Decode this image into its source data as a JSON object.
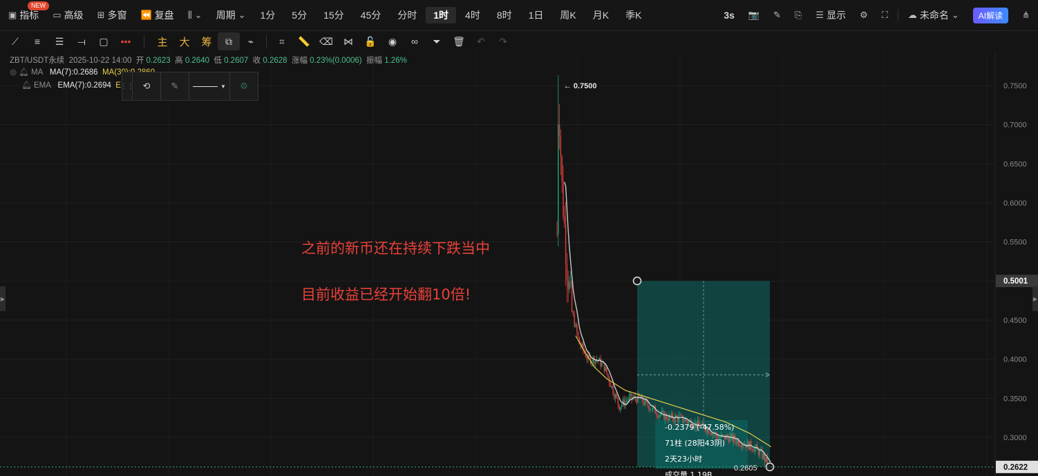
{
  "toolbar": {
    "indicators": "指标",
    "new_badge": "NEW",
    "advanced": "高级",
    "multi_window": "多窗",
    "replay": "复盘",
    "period": "周期",
    "timeframes": [
      "1分",
      "5分",
      "15分",
      "45分",
      "分时",
      "1时",
      "4时",
      "8时",
      "1日",
      "周K",
      "月K",
      "季K"
    ],
    "active_timeframe": "1时",
    "refresh": "3s",
    "display": "显示",
    "unnamed": "未命名",
    "ai": "AI解读"
  },
  "drawbar": {
    "main": "主",
    "big": "大",
    "chips": "筹"
  },
  "legend": {
    "symbol": "ZBT/USDT永续",
    "datetime": "2025-10-22 14:00",
    "open_label": "开",
    "open": "0.2623",
    "high_label": "高",
    "high": "0.2640",
    "low_label": "低",
    "low": "0.2607",
    "close_label": "收",
    "close": "0.2628",
    "change_label": "涨幅",
    "change": "0.23%(0.0006)",
    "amp_label": "振幅",
    "amp": "1.26%",
    "ma_label": "MA",
    "ma7": "MA(7):0.2686",
    "ma30": "MA(30):0.2860",
    "ema_label": "EMA",
    "ema7": "EMA(7):0.2694",
    "ema_more": "E"
  },
  "annotations": {
    "line1": "之前的新币还在持续下跌当中",
    "line2": "目前收益已经开始翻10倍!"
  },
  "chart_data": {
    "type": "candlestick",
    "ylim": [
      0.26,
      0.76
    ],
    "y_ticks": [
      "0.7500",
      "0.7000",
      "0.6500",
      "0.6000",
      "0.5500",
      "0.5000",
      "0.4500",
      "0.4000",
      "0.3500",
      "0.3000"
    ],
    "y_tick_values": [
      0.75,
      0.7,
      0.65,
      0.6,
      0.55,
      0.5,
      0.45,
      0.4,
      0.35,
      0.3
    ],
    "high_marker": "0.7500",
    "high_value": 0.75,
    "price_tags": [
      {
        "label": "0.5001",
        "value": 0.5001
      },
      {
        "label": "0.2622",
        "value": 0.2622
      }
    ],
    "anchors": [
      {
        "t": 0,
        "p": 0.56
      },
      {
        "t": 1,
        "p": 0.75
      },
      {
        "t": 4,
        "p": 0.62
      },
      {
        "t": 8,
        "p": 0.52
      },
      {
        "t": 12,
        "p": 0.46
      },
      {
        "t": 18,
        "p": 0.42
      },
      {
        "t": 25,
        "p": 0.4
      },
      {
        "t": 32,
        "p": 0.4
      },
      {
        "t": 38,
        "p": 0.39
      },
      {
        "t": 45,
        "p": 0.36
      },
      {
        "t": 50,
        "p": 0.34
      },
      {
        "t": 58,
        "p": 0.35
      },
      {
        "t": 66,
        "p": 0.35
      },
      {
        "t": 74,
        "p": 0.34
      },
      {
        "t": 82,
        "p": 0.33
      },
      {
        "t": 90,
        "p": 0.325
      },
      {
        "t": 98,
        "p": 0.325
      },
      {
        "t": 106,
        "p": 0.32
      },
      {
        "t": 114,
        "p": 0.315
      },
      {
        "t": 122,
        "p": 0.31
      },
      {
        "t": 130,
        "p": 0.3
      },
      {
        "t": 138,
        "p": 0.3
      },
      {
        "t": 146,
        "p": 0.295
      },
      {
        "t": 154,
        "p": 0.29
      },
      {
        "t": 160,
        "p": 0.285
      },
      {
        "t": 166,
        "p": 0.275
      },
      {
        "t": 170,
        "p": 0.263
      }
    ],
    "ma30_series": [
      {
        "t": 15,
        "p": 0.43
      },
      {
        "t": 22,
        "p": 0.41
      },
      {
        "t": 30,
        "p": 0.39
      },
      {
        "t": 40,
        "p": 0.375
      },
      {
        "t": 55,
        "p": 0.36
      },
      {
        "t": 75,
        "p": 0.35
      },
      {
        "t": 95,
        "p": 0.34
      },
      {
        "t": 115,
        "p": 0.33
      },
      {
        "t": 135,
        "p": 0.32
      },
      {
        "t": 155,
        "p": 0.305
      },
      {
        "t": 172,
        "p": 0.288
      }
    ],
    "measure": {
      "top": 0.5001,
      "bottom": 0.2622,
      "change": "-0.2379 (-47.58%)",
      "bars": "71柱 (28阳43阴)",
      "duration": "2天23小时",
      "volume": "成交量 1.19B",
      "end_label": "0.2605"
    }
  },
  "colors": {
    "up": "#27a17a",
    "down": "#e0403c",
    "ma7": "#e6e6e6",
    "ma30": "#e6d04a",
    "measure": "#0f6a66"
  }
}
